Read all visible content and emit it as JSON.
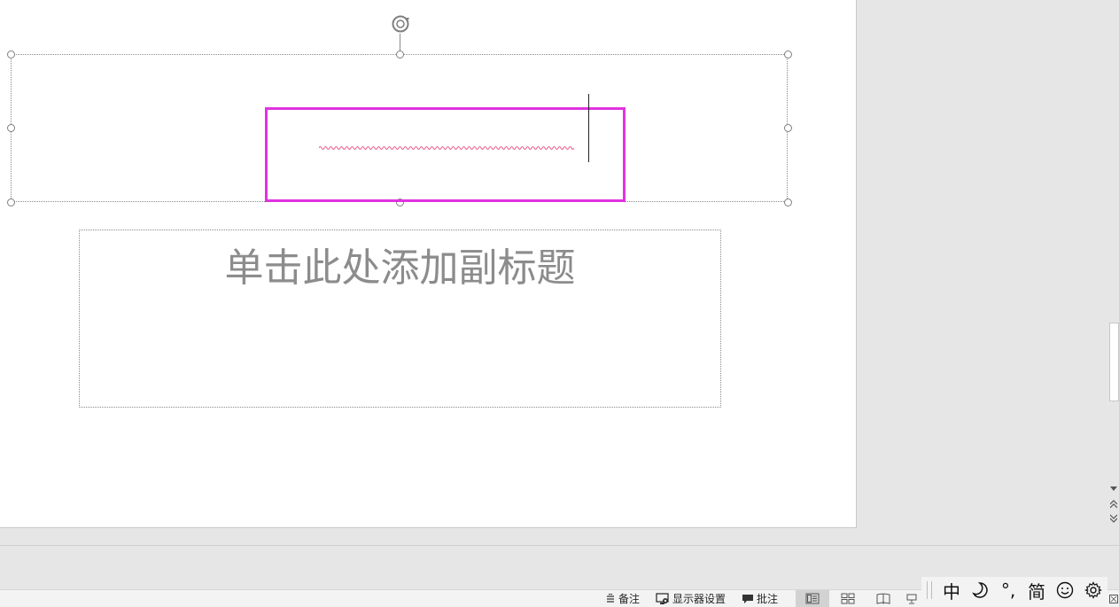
{
  "slide": {
    "subtitle_placeholder": "单击此处添加副标题"
  },
  "status_bar": {
    "notes_label": "备注",
    "display_settings_label": "显示器设置",
    "comments_label": "批注",
    "views": [
      {
        "icon": "normal-view-icon",
        "active": true
      },
      {
        "icon": "slide-sorter-icon",
        "active": false
      },
      {
        "icon": "reading-view-icon",
        "active": false
      },
      {
        "icon": "slideshow-icon",
        "active": false
      }
    ]
  },
  "ime_toolbar": {
    "mode": "中",
    "punctuation": "°,",
    "charset": "简"
  },
  "colors": {
    "highlight": "#e033e0",
    "spellcheck": "#e85b8a",
    "placeholder_text": "#8c8c8c"
  }
}
